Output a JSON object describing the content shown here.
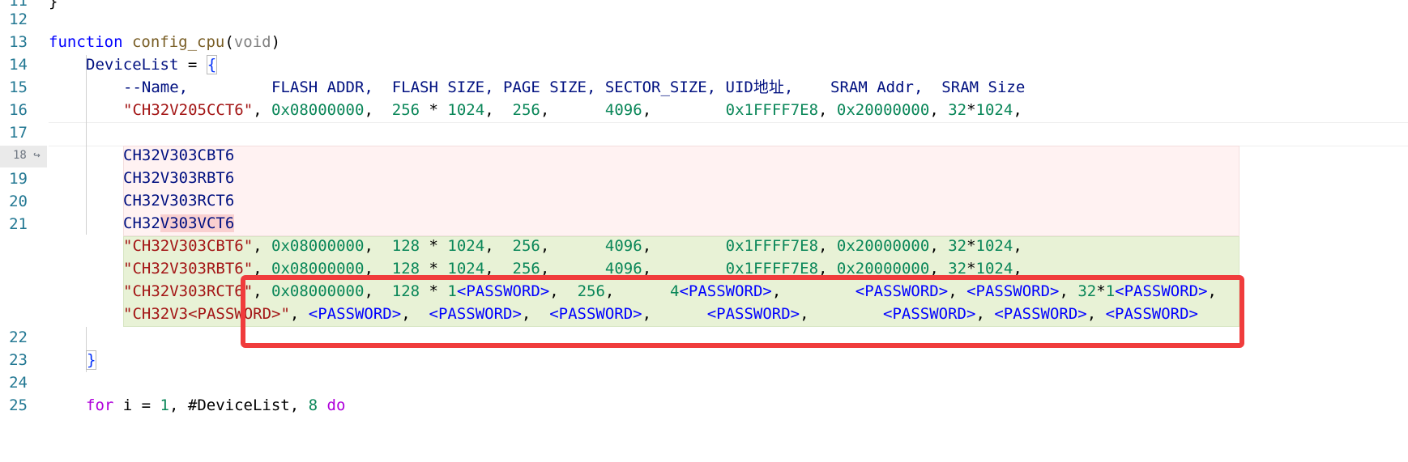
{
  "lines": {
    "l11": {
      "num": "11",
      "text": "}"
    },
    "l12": {
      "num": "12"
    },
    "l13": {
      "num": "13",
      "kw": "function",
      "name": "config_cpu",
      "open": "(",
      "param": "void",
      "close": ")"
    },
    "l14": {
      "num": "14",
      "id": "DeviceList",
      "op": " = ",
      "brace": "{"
    },
    "l15": {
      "num": "15",
      "text": "--Name,         FLASH ADDR,  FLASH SIZE, PAGE SIZE, SECTOR_SIZE, UID地址,    SRAM Addr,  SRAM Size"
    },
    "l16": {
      "num": "16",
      "str": "\"CH32V205CCT6\"",
      "c1": ", ",
      "a": "0x08000000",
      "c2": ",  ",
      "b1": "256",
      "b2": " * ",
      "b3": "1024",
      "c3": ",  ",
      "p": "256",
      "c4": ",      ",
      "s": "4096",
      "c5": ",        ",
      "u": "0x1FFFF7E8",
      "c6": ", ",
      "r": "0x20000000",
      "c7": ", ",
      "m1": "32",
      "m2": "*",
      "m3": "1024",
      "c8": ","
    },
    "l17": {
      "num": "17"
    },
    "l18": {
      "num": "18",
      "arrow": "↪",
      "text": "CH32V303CBT6"
    },
    "l19": {
      "num": "19",
      "text": "CH32V303RBT6"
    },
    "l20": {
      "num": "20",
      "text": "CH32V303RCT6"
    },
    "l21": {
      "num": "21",
      "pre": "CH32",
      "hl": "V303VCT6"
    },
    "a1": {
      "str": "\"CH32V303CBT6\"",
      "c1": ", ",
      "a": "0x08000000",
      "c2": ",  ",
      "b1": "128",
      "b2": " * ",
      "b3": "1024",
      "c3": ",  ",
      "p": "256",
      "c4": ",      ",
      "s": "4096",
      "c5": ",        ",
      "u": "0x1FFFF7E8",
      "c6": ", ",
      "r": "0x20000000",
      "c7": ", ",
      "m1": "32",
      "m2": "*",
      "m3": "1024",
      "c8": ","
    },
    "a2": {
      "str": "\"CH32V303RBT6\"",
      "c1": ", ",
      "a": "0x08000000",
      "c2": ",  ",
      "b1": "128",
      "b2": " * ",
      "b3": "1024",
      "c3": ",  ",
      "p": "256",
      "c4": ",      ",
      "s": "4096",
      "c5": ",        ",
      "u": "0x1FFFF7E8",
      "c6": ", ",
      "r": "0x20000000",
      "c7": ", ",
      "m1": "32",
      "m2": "*",
      "m3": "1024",
      "c8": ","
    },
    "a3": {
      "str": "\"CH32V303RCT6\"",
      "c1": ", ",
      "a": "0x08000000",
      "c2": ",  ",
      "b1": "128",
      "b2": " * ",
      "b3": "1",
      "pw1": "<PASSWORD>",
      "c3": ",  ",
      "p": "256",
      "c4": ",      ",
      "s": "4",
      "pw2": "<PASSWORD>",
      "c5": ",        ",
      "pw3": "<PASSWORD>",
      "c6": ", ",
      "pw4": "<PASSWORD>",
      "c7": ", ",
      "m1": "32",
      "m2": "*",
      "m3": "1",
      "pw5": "<PASSWORD>",
      "c8": ","
    },
    "a4": {
      "str": "\"CH32V3<PASSWORD>\"",
      "c1": ", ",
      "pw1": "<PASSWORD>",
      "c2": ",  ",
      "pw2": "<PASSWORD>",
      "c3": ",  ",
      "pw3": "<PASSWORD>",
      "c4": ",      ",
      "pw4": "<PASSWORD>",
      "c5": ",        ",
      "pw5": "<PASSWORD>",
      "c6": ", ",
      "pw6": "<PASSWORD>",
      "c7": ", ",
      "pw7": "<PASSWORD>"
    },
    "l22": {
      "num": "22"
    },
    "l23": {
      "num": "23",
      "brace": "}"
    },
    "l24": {
      "num": "24"
    },
    "l25": {
      "num": "25",
      "kw": "for",
      "i": " i = ",
      "one": "1",
      "c1": ", ",
      "hash": "#DeviceList",
      "c2": ", ",
      "eight": "8",
      "do": " do"
    }
  },
  "colors": {
    "highlight_box": "#f03c3c",
    "added_bg": "#e8f2d6",
    "deleted_bg": "#fff2f2",
    "line_number": "#237893"
  }
}
